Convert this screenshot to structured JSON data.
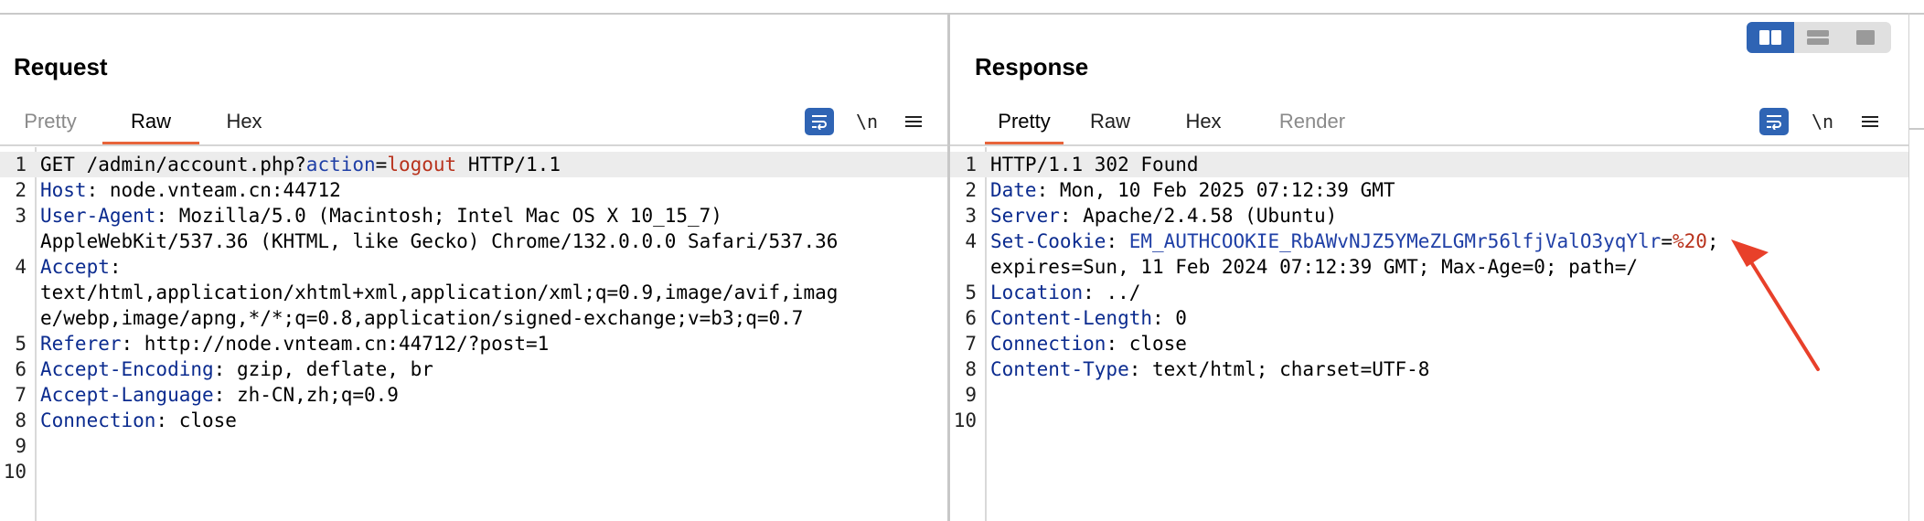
{
  "request": {
    "title": "Request",
    "tabs": [
      {
        "label": "Pretty"
      },
      {
        "label": "Raw"
      },
      {
        "label": "Hex"
      }
    ],
    "active_tab": "Raw",
    "newline_toggle": "\\n",
    "icons": {
      "wrap": "wrap-text-icon",
      "menu": "hamburger-menu-icon"
    },
    "lines": [
      {
        "n": "1",
        "parts": [
          "GET /admin/account.php?",
          "action",
          "=",
          "logout",
          " HTTP/1.1"
        ]
      },
      {
        "n": "2",
        "parts": [
          "Host",
          ": node.vnteam.cn:44712"
        ]
      },
      {
        "n": "3",
        "parts": [
          "User-Agent",
          ": Mozilla/5.0 (Macintosh; Intel Mac OS X 10_15_7)"
        ]
      },
      {
        "n": "",
        "parts": [
          "AppleWebKit/537.36 (KHTML, like Gecko) Chrome/132.0.0.0 Safari/537.36"
        ]
      },
      {
        "n": "4",
        "parts": [
          "Accept",
          ":"
        ]
      },
      {
        "n": "",
        "parts": [
          "text/html,application/xhtml+xml,application/xml;q=0.9,image/avif,imag"
        ]
      },
      {
        "n": "",
        "parts": [
          "e/webp,image/apng,*/*;q=0.8,application/signed-exchange;v=b3;q=0.7"
        ]
      },
      {
        "n": "5",
        "parts": [
          "Referer",
          ": http://node.vnteam.cn:44712/?post=1"
        ]
      },
      {
        "n": "6",
        "parts": [
          "Accept-Encoding",
          ": gzip, deflate, br"
        ]
      },
      {
        "n": "7",
        "parts": [
          "Accept-Language",
          ": zh-CN,zh;q=0.9"
        ]
      },
      {
        "n": "8",
        "parts": [
          "Connection",
          ": close"
        ]
      },
      {
        "n": "9",
        "parts": [
          ""
        ]
      },
      {
        "n": "10",
        "parts": [
          ""
        ]
      }
    ]
  },
  "response": {
    "title": "Response",
    "tabs": [
      {
        "label": "Pretty"
      },
      {
        "label": "Raw"
      },
      {
        "label": "Hex"
      },
      {
        "label": "Render"
      }
    ],
    "active_tab": "Pretty",
    "newline_toggle": "\\n",
    "icons": {
      "wrap": "wrap-text-icon",
      "menu": "hamburger-menu-icon"
    },
    "lines": [
      {
        "n": "1",
        "parts": [
          "HTTP/1.1 302 Found"
        ]
      },
      {
        "n": "2",
        "parts": [
          "Date",
          ": Mon, 10 Feb 2025 07:12:39 GMT"
        ]
      },
      {
        "n": "3",
        "parts": [
          "Server",
          ": Apache/2.4.58 (Ubuntu)"
        ]
      },
      {
        "n": "4",
        "parts": [
          "Set-Cookie",
          ": ",
          "EM_AUTHCOOKIE_RbAWvNJZ5YMeZLGMr56lfjValO3yqYlr",
          "=",
          "%20",
          ";"
        ]
      },
      {
        "n": "",
        "parts": [
          "expires=Sun, 11 Feb 2024 07:12:39 GMT; Max-Age=0; path=/"
        ]
      },
      {
        "n": "5",
        "parts": [
          "Location",
          ": ../"
        ]
      },
      {
        "n": "6",
        "parts": [
          "Content-Length",
          ": 0"
        ]
      },
      {
        "n": "7",
        "parts": [
          "Connection",
          ": close"
        ]
      },
      {
        "n": "8",
        "parts": [
          "Content-Type",
          ": text/html; charset=UTF-8"
        ]
      },
      {
        "n": "9",
        "parts": [
          ""
        ]
      },
      {
        "n": "10",
        "parts": [
          ""
        ]
      }
    ]
  },
  "layout_toggle": {
    "icons": [
      "split-horizontal-icon",
      "split-vertical-icon",
      "single-pane-icon"
    ],
    "active_index": 0
  },
  "colors": {
    "accent": "#e8643a",
    "brand": "#2f64b4",
    "header_name": "#0b2b8f",
    "param_value": "#b8321c",
    "annotation_arrow": "#e8402a"
  }
}
